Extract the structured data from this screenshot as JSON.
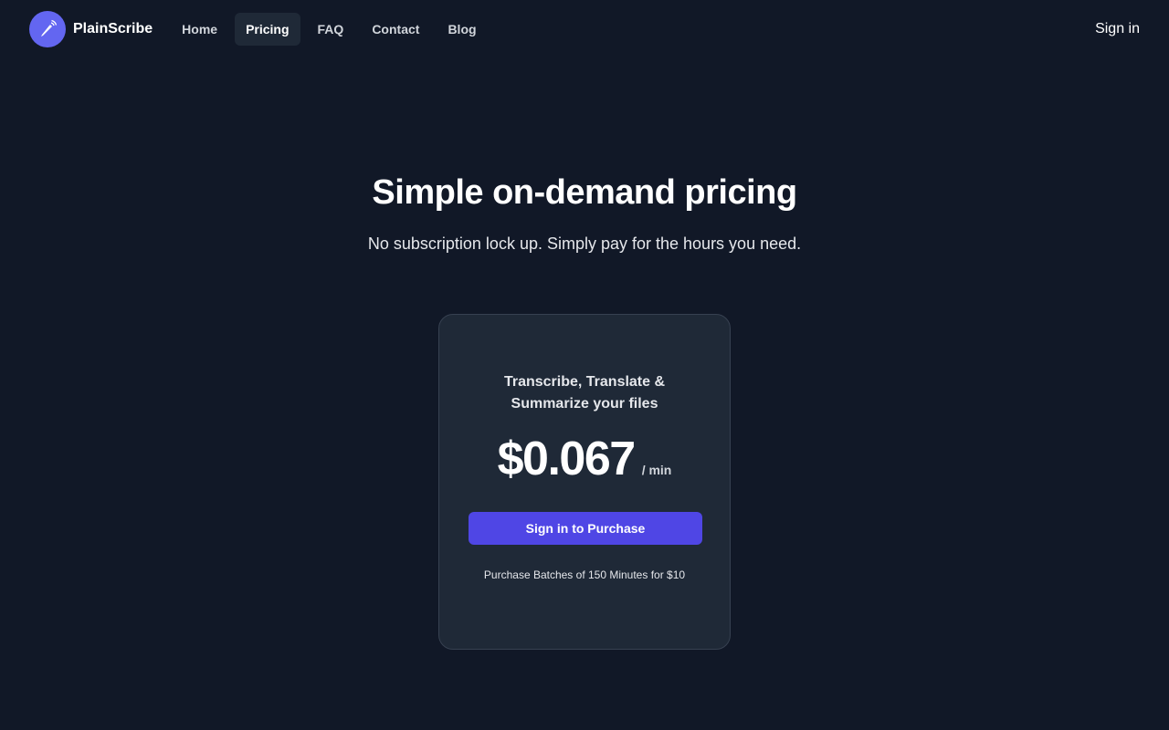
{
  "brand": {
    "name": "PlainScribe",
    "logo_icon": "pencil-broadcast-icon",
    "logo_color": "#6366f1"
  },
  "nav": {
    "items": [
      {
        "label": "Home",
        "active": false
      },
      {
        "label": "Pricing",
        "active": true
      },
      {
        "label": "FAQ",
        "active": false
      },
      {
        "label": "Contact",
        "active": false
      },
      {
        "label": "Blog",
        "active": false
      }
    ],
    "signin_label": "Sign in"
  },
  "hero": {
    "title": "Simple on-demand pricing",
    "subtitle": "No subscription lock up. Simply pay for the hours you need."
  },
  "pricing_card": {
    "heading_line1": "Transcribe, Translate &",
    "heading_line2": "Summarize your files",
    "price": "$0.067",
    "unit": "/ min",
    "button_label": "Sign in to Purchase",
    "note": "Purchase Batches of 150 Minutes for $10"
  },
  "colors": {
    "background": "#111827",
    "card": "#1f2937",
    "accent": "#4f46e5"
  }
}
